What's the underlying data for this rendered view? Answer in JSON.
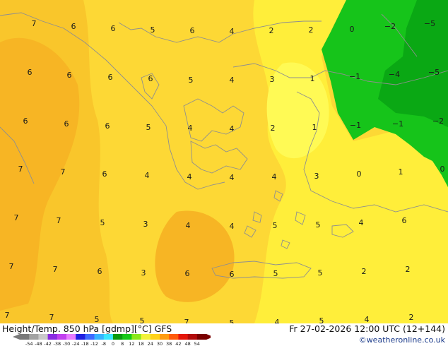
{
  "colors": {
    "field_base": "#FDD835",
    "field_warm": "#F9C62B",
    "field_warmer": "#F7B524",
    "field_bright": "#FFEE3A",
    "field_pale": "#FFFA55",
    "field_green": "#16C41A",
    "field_green_dark": "#0AA814",
    "coast": "#8f8f8f"
  },
  "map_values": [
    {
      "t": "7"
    },
    {
      "t": "6"
    },
    {
      "t": "6"
    },
    {
      "t": "5"
    },
    {
      "t": "6"
    },
    {
      "t": "4"
    },
    {
      "t": "2"
    },
    {
      "t": "2"
    },
    {
      "t": "0"
    },
    {
      "t": "−2"
    },
    {
      "t": "−5"
    },
    {
      "t": "6"
    },
    {
      "t": "6"
    },
    {
      "t": "6"
    },
    {
      "t": "6"
    },
    {
      "t": "5"
    },
    {
      "t": "4"
    },
    {
      "t": "3"
    },
    {
      "t": "1"
    },
    {
      "t": "−1"
    },
    {
      "t": "−4"
    },
    {
      "t": "−5"
    },
    {
      "t": "6"
    },
    {
      "t": "6"
    },
    {
      "t": "6"
    },
    {
      "t": "5"
    },
    {
      "t": "4"
    },
    {
      "t": "4"
    },
    {
      "t": "2"
    },
    {
      "t": "1"
    },
    {
      "t": "−1"
    },
    {
      "t": "−1"
    },
    {
      "t": "−2"
    },
    {
      "t": "7"
    },
    {
      "t": "7"
    },
    {
      "t": "6"
    },
    {
      "t": "4"
    },
    {
      "t": "4"
    },
    {
      "t": "4"
    },
    {
      "t": "4"
    },
    {
      "t": "3"
    },
    {
      "t": "0"
    },
    {
      "t": "1"
    },
    {
      "t": "0"
    },
    {
      "t": "7"
    },
    {
      "t": "7"
    },
    {
      "t": "5"
    },
    {
      "t": "3"
    },
    {
      "t": "4"
    },
    {
      "t": "4"
    },
    {
      "t": "5"
    },
    {
      "t": "5"
    },
    {
      "t": "4"
    },
    {
      "t": "6"
    },
    {
      "t": "7"
    },
    {
      "t": "7"
    },
    {
      "t": "6"
    },
    {
      "t": "3"
    },
    {
      "t": "6"
    },
    {
      "t": "6"
    },
    {
      "t": "5"
    },
    {
      "t": "5"
    },
    {
      "t": "2"
    },
    {
      "t": "2"
    },
    {
      "t": "7"
    },
    {
      "t": "7"
    },
    {
      "t": "5"
    },
    {
      "t": "5"
    },
    {
      "t": "7"
    },
    {
      "t": "5"
    },
    {
      "t": "4"
    },
    {
      "t": "5"
    },
    {
      "t": "4"
    },
    {
      "t": "2"
    }
  ],
  "footer": {
    "title": "Height/Temp. 850 hPa [gdmp][°C] GFS",
    "datetime": "Fr 27-02-2026 12:00 UTC (12+144)",
    "credit": "©weatheronline.co.uk"
  },
  "legend": {
    "ticks": [
      "-54",
      "-48",
      "-42",
      "-38",
      "-30",
      "-24",
      "-18",
      "-12",
      "-8",
      "0",
      "8",
      "12",
      "18",
      "24",
      "30",
      "38",
      "42",
      "48",
      "54"
    ],
    "colors": [
      "#7a7a7a",
      "#a3a3a3",
      "#c9c9c9",
      "#8a2be2",
      "#c140ef",
      "#e87bff",
      "#2020e0",
      "#3d6bff",
      "#36b4ff",
      "#39e6ff",
      "#0a9a10",
      "#17c818",
      "#8be81a",
      "#f2f23a",
      "#ffd21a",
      "#ff9c0f",
      "#ff5a0a",
      "#e5160a",
      "#b20b0b",
      "#7a0000"
    ]
  }
}
